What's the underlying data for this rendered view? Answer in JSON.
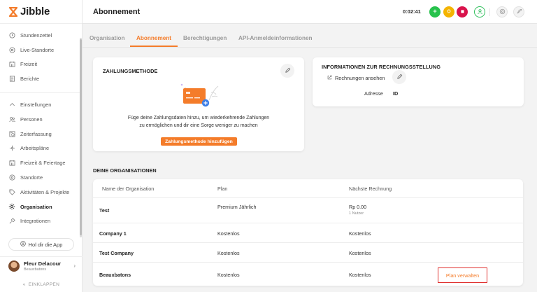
{
  "app": {
    "name": "Jibble"
  },
  "sidebar": {
    "items": [
      {
        "label": "Stundenzettel",
        "icon": "clock-icon"
      },
      {
        "label": "Live-Standorte",
        "icon": "location-pin-icon"
      },
      {
        "label": "Freizeit",
        "icon": "calendar-icon"
      },
      {
        "label": "Berichte",
        "icon": "report-icon"
      }
    ],
    "settings_items": [
      {
        "label": "Einstellungen",
        "icon": "chevron-up-icon"
      },
      {
        "label": "Personen",
        "icon": "people-icon"
      },
      {
        "label": "Zeiterfassung",
        "icon": "time-tracking-icon"
      },
      {
        "label": "Arbeitspläne",
        "icon": "schedule-icon"
      },
      {
        "label": "Freizeit & Feiertage",
        "icon": "calendar-icon"
      },
      {
        "label": "Standorte",
        "icon": "location-pin-icon"
      },
      {
        "label": "Aktivitäten & Projekte",
        "icon": "tag-icon"
      },
      {
        "label": "Organisation",
        "icon": "gear-icon",
        "active": true
      },
      {
        "label": "Integrationen",
        "icon": "plug-icon"
      }
    ],
    "app_button": "Hol dir die App",
    "profile": {
      "name": "Fleur Delacour",
      "org": "Beauxbatons"
    },
    "collapse_label": "EINKLAPPEN"
  },
  "header": {
    "title": "Abonnement",
    "timer": "0:02:41"
  },
  "tabs": [
    {
      "label": "Organisation",
      "active": false
    },
    {
      "label": "Abonnement",
      "active": true
    },
    {
      "label": "Berechtigungen",
      "active": false
    },
    {
      "label": "API-Anmeldeinformationen",
      "active": false
    }
  ],
  "payment": {
    "title": "ZAHLUNGSMETHODE",
    "description_line1": "Füge deine Zahlungsdaten hinzu, um wiederkehrende Zahlungen",
    "description_line2": "zu ermöglichen und dir eine Sorge weniger zu machen",
    "button": "Zahlungsmethode hinzufügen"
  },
  "invoice": {
    "title": "INFORMATIONEN ZUR RECHNUNGSSTELLUNG",
    "view_link": "Rechnungen ansehen",
    "address_label": "Adresse",
    "address_value": "ID"
  },
  "organizations": {
    "title": "DEINE ORGANISATIONEN",
    "headers": {
      "name": "Name der Organisation",
      "plan": "Plan",
      "next": "Nächste Rechnung"
    },
    "rows": [
      {
        "name": "Test",
        "plan": "Premium Jährlich",
        "next": "Rp 0.00",
        "next_sub": "1 Nutzer"
      },
      {
        "name": "Company 1",
        "plan": "Kostenlos",
        "next": "Kostenlos"
      },
      {
        "name": "Test Company",
        "plan": "Kostenlos",
        "next": "Kostenlos"
      },
      {
        "name": "Beauxbatons",
        "plan": "Kostenlos",
        "next": "Kostenlos",
        "action": "Plan verwalten"
      }
    ]
  },
  "colors": {
    "accent": "#f47c2a",
    "highlight_border": "#e0312f"
  }
}
